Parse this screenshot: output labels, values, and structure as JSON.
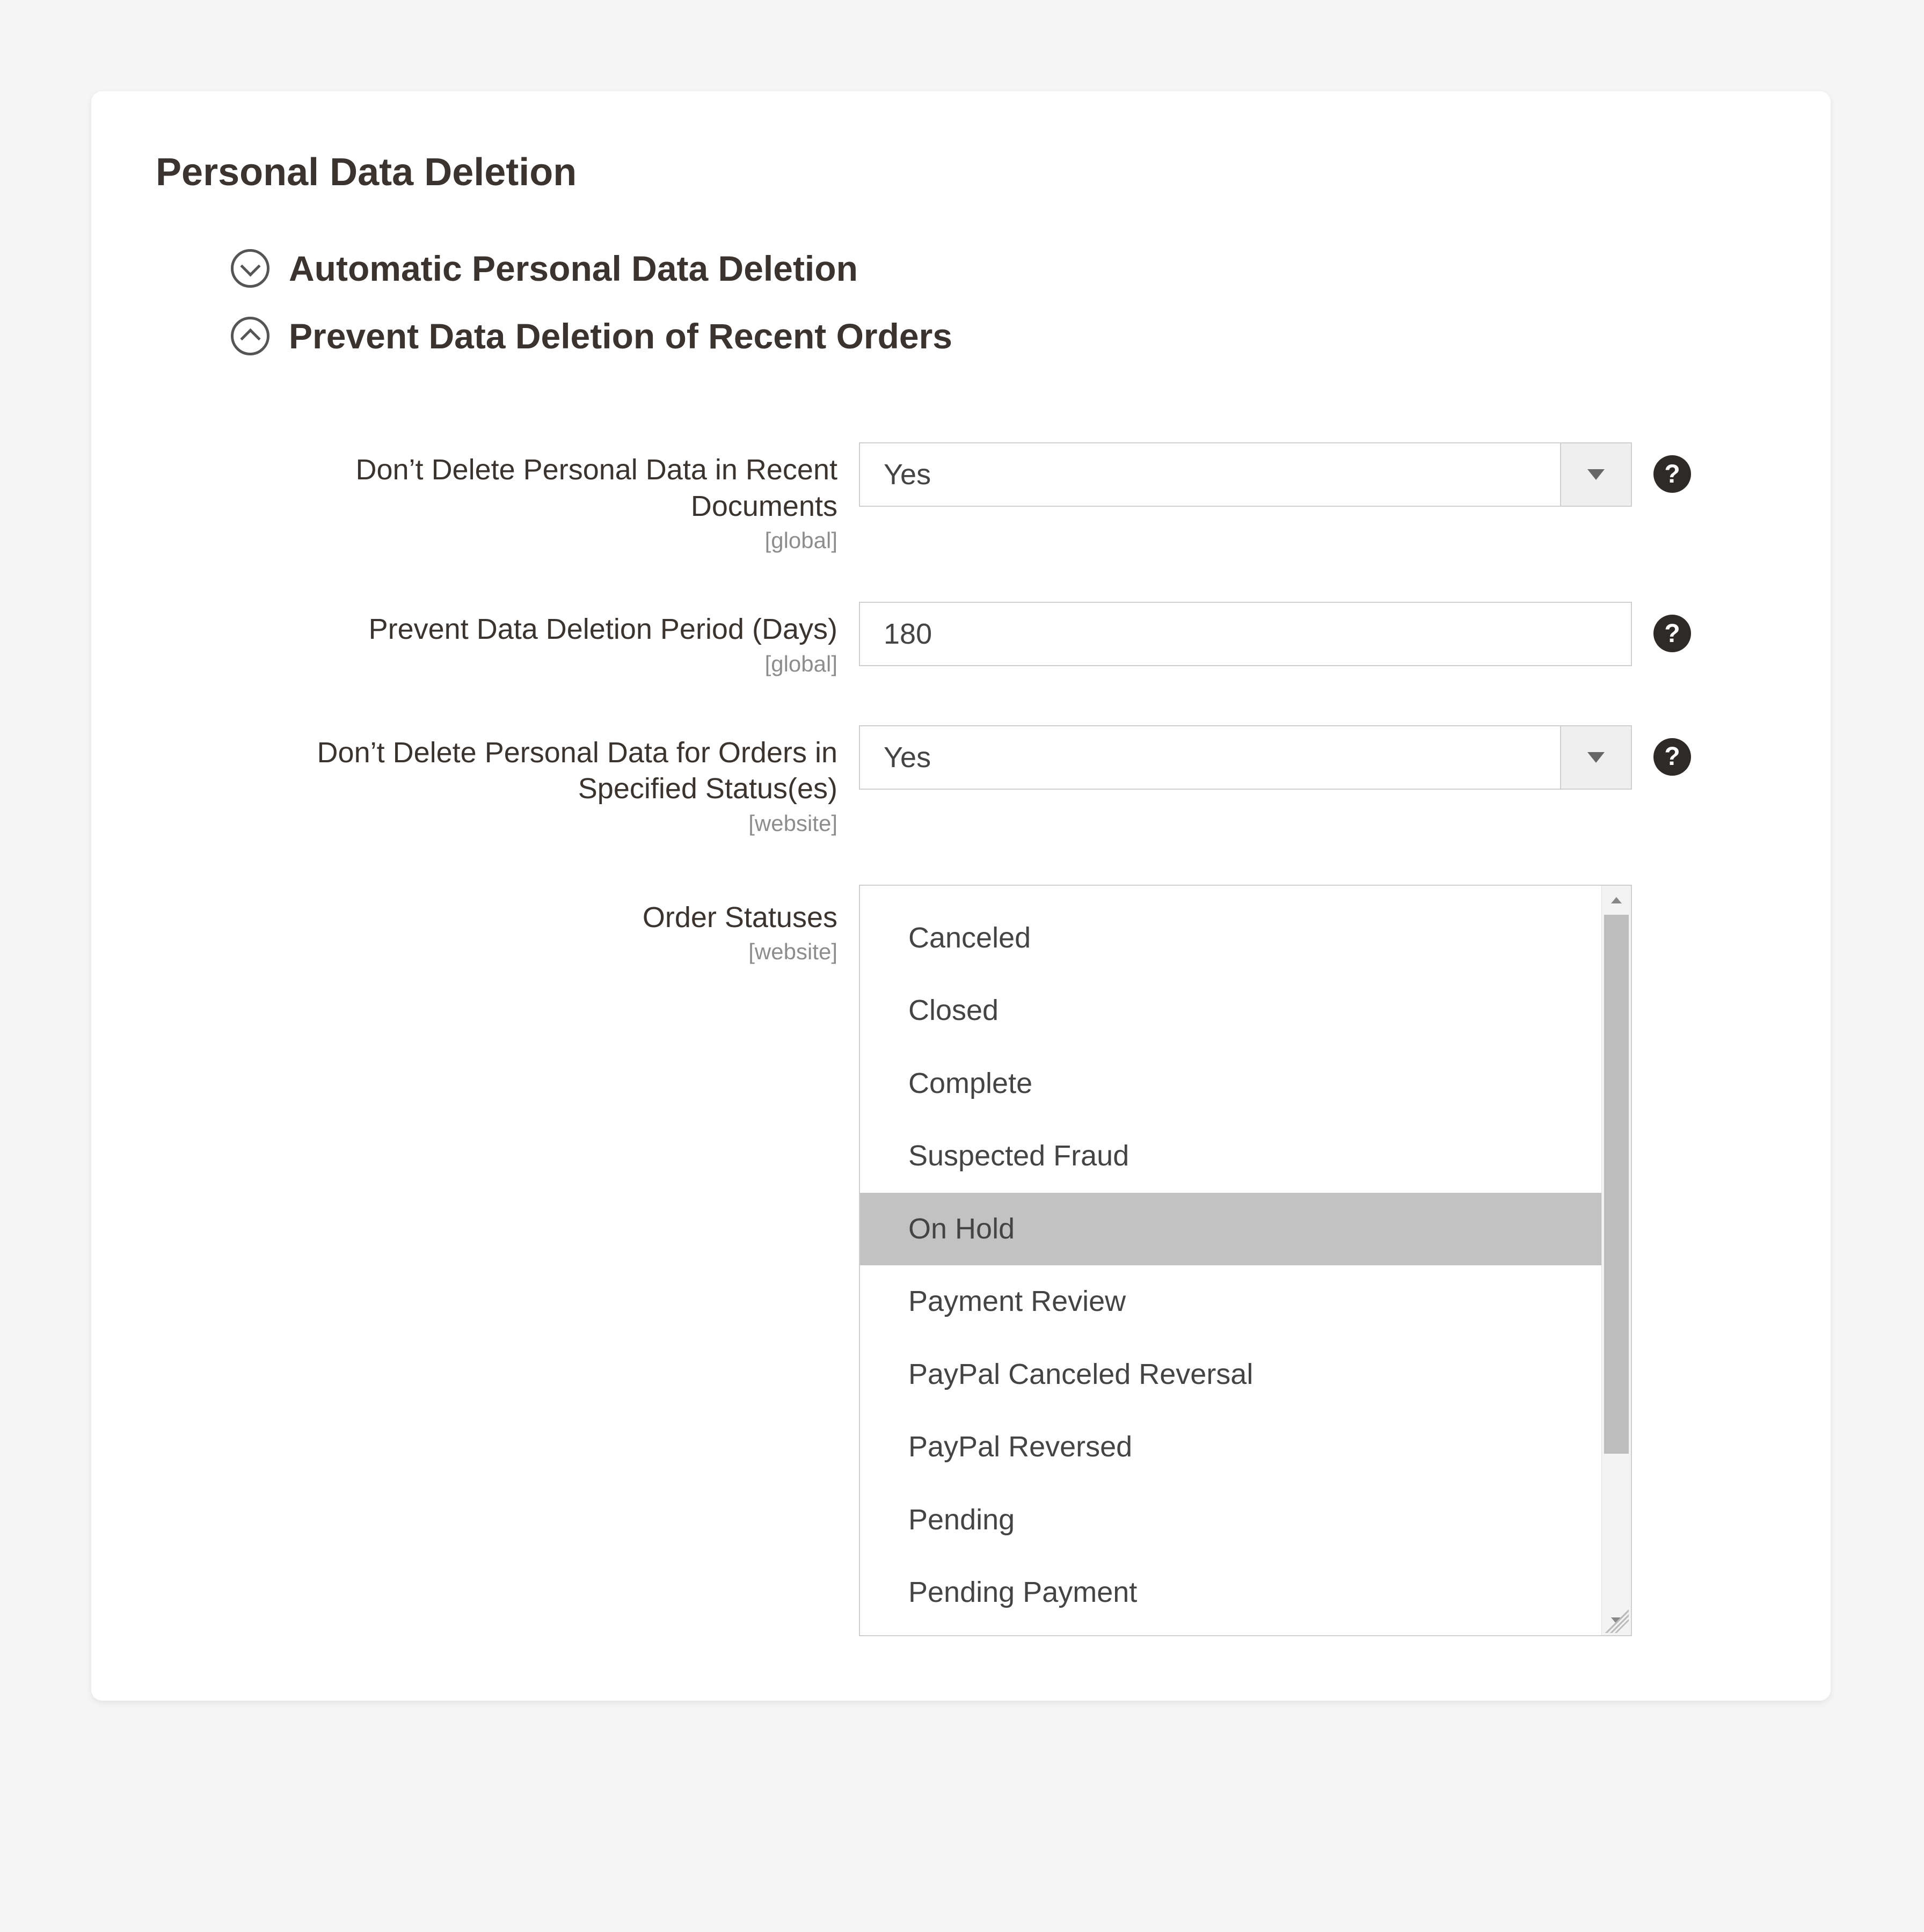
{
  "panel": {
    "title": "Personal Data Deletion"
  },
  "sections": {
    "auto": {
      "title": "Automatic Personal Data Deletion",
      "expanded": false
    },
    "prevent": {
      "title": "Prevent Data Deletion of Recent Orders",
      "expanded": true
    }
  },
  "scope": {
    "global": "[global]",
    "website": "[website]"
  },
  "fields": {
    "dontDeleteRecent": {
      "label": "Don’t Delete Personal Data in Recent Documents",
      "value": "Yes",
      "scope": "global"
    },
    "period": {
      "label": "Prevent Data Deletion Period (Days)",
      "value": "180",
      "scope": "global"
    },
    "dontDeleteStatus": {
      "label": "Don’t Delete Personal Data for Orders in Specified Status(es)",
      "value": "Yes",
      "scope": "website"
    },
    "orderStatuses": {
      "label": "Order Statuses",
      "scope": "website",
      "options": [
        "Canceled",
        "Closed",
        "Complete",
        "Suspected Fraud",
        "On Hold",
        "Payment Review",
        "PayPal Canceled Reversal",
        "PayPal Reversed",
        "Pending",
        "Pending Payment"
      ],
      "selected": [
        "On Hold"
      ]
    }
  },
  "help_glyph": "?"
}
